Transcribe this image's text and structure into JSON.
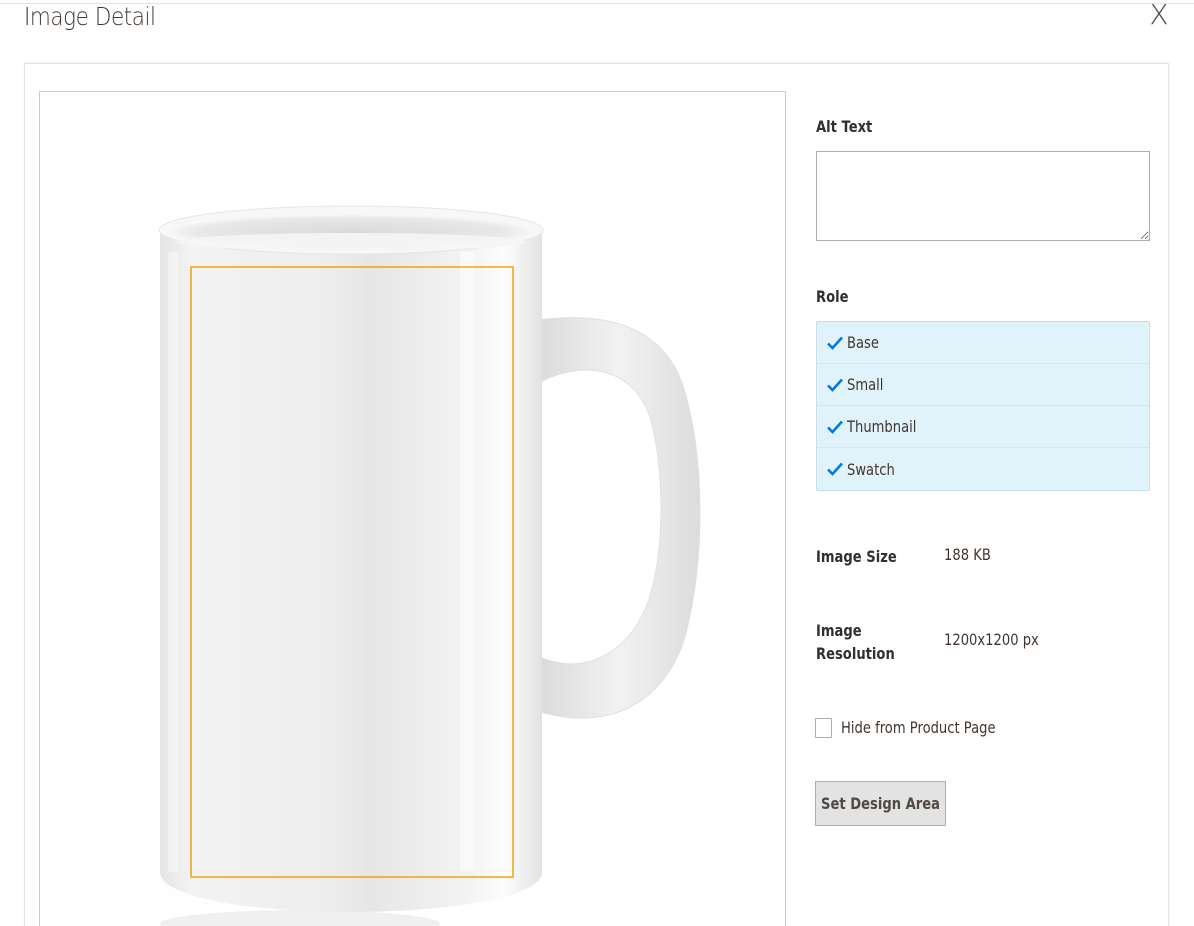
{
  "modal": {
    "title": "Image Detail",
    "close_label": "X"
  },
  "image": {
    "design_area_color": "#f0a30a"
  },
  "alt_text": {
    "label": "Alt Text",
    "value": ""
  },
  "role": {
    "label": "Role",
    "items": [
      {
        "label": "Base",
        "checked": true
      },
      {
        "label": "Small",
        "checked": true
      },
      {
        "label": "Thumbnail",
        "checked": true
      },
      {
        "label": "Swatch",
        "checked": true
      }
    ],
    "check_color": "#007bdb"
  },
  "image_size": {
    "label": "Image Size",
    "value": "188 KB"
  },
  "image_resolution": {
    "label_line1": "Image",
    "label_line2": "Resolution",
    "value": "1200x1200 px"
  },
  "hide_from_product_page": {
    "label": "Hide from Product Page",
    "checked": false
  },
  "set_design_area": {
    "label": "Set Design Area"
  }
}
